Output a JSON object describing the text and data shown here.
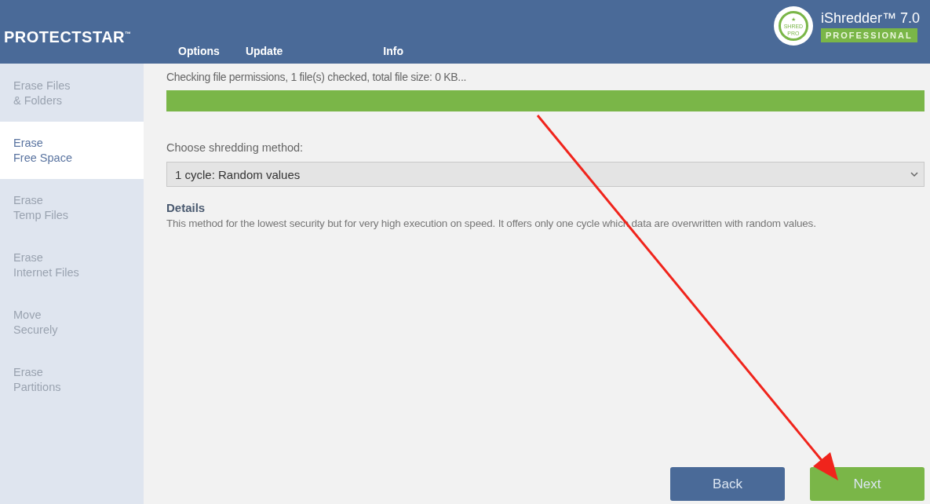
{
  "header": {
    "brand": "PROTECTSTAR",
    "brand_mark": "™",
    "menu": [
      {
        "label": "Options"
      },
      {
        "label": "Update"
      },
      {
        "label": "Info"
      }
    ],
    "badge": {
      "star": "★",
      "top": "SHRED",
      "bottom": "PRO"
    },
    "product": "iShredder™ 7.0",
    "edition": "PROFESSIONAL"
  },
  "sidebar": {
    "items": [
      {
        "line1": "Erase Files",
        "line2": "& Folders",
        "selected": false
      },
      {
        "line1": "Erase",
        "line2": "Free Space",
        "selected": true
      },
      {
        "line1": "Erase",
        "line2": "Temp Files",
        "selected": false
      },
      {
        "line1": "Erase",
        "line2": "Internet Files",
        "selected": false
      },
      {
        "line1": "Move",
        "line2": "Securely",
        "selected": false
      },
      {
        "line1": "Erase",
        "line2": "Partitions",
        "selected": false
      }
    ]
  },
  "status": {
    "text": "Checking file permissions, 1 file(s) checked, total file size: 0 KB...",
    "level": 1
  },
  "method": {
    "label": "Choose shredding method:",
    "value": "1 cycle: Random values"
  },
  "details": {
    "title": "Details",
    "text": "This method for the lowest security but for very high execution on speed. It offers only one cycle which data are overwritten with random values."
  },
  "buttons": [
    {
      "label": "Back",
      "kind": "secondary"
    },
    {
      "label": "Next",
      "kind": "primary"
    }
  ]
}
